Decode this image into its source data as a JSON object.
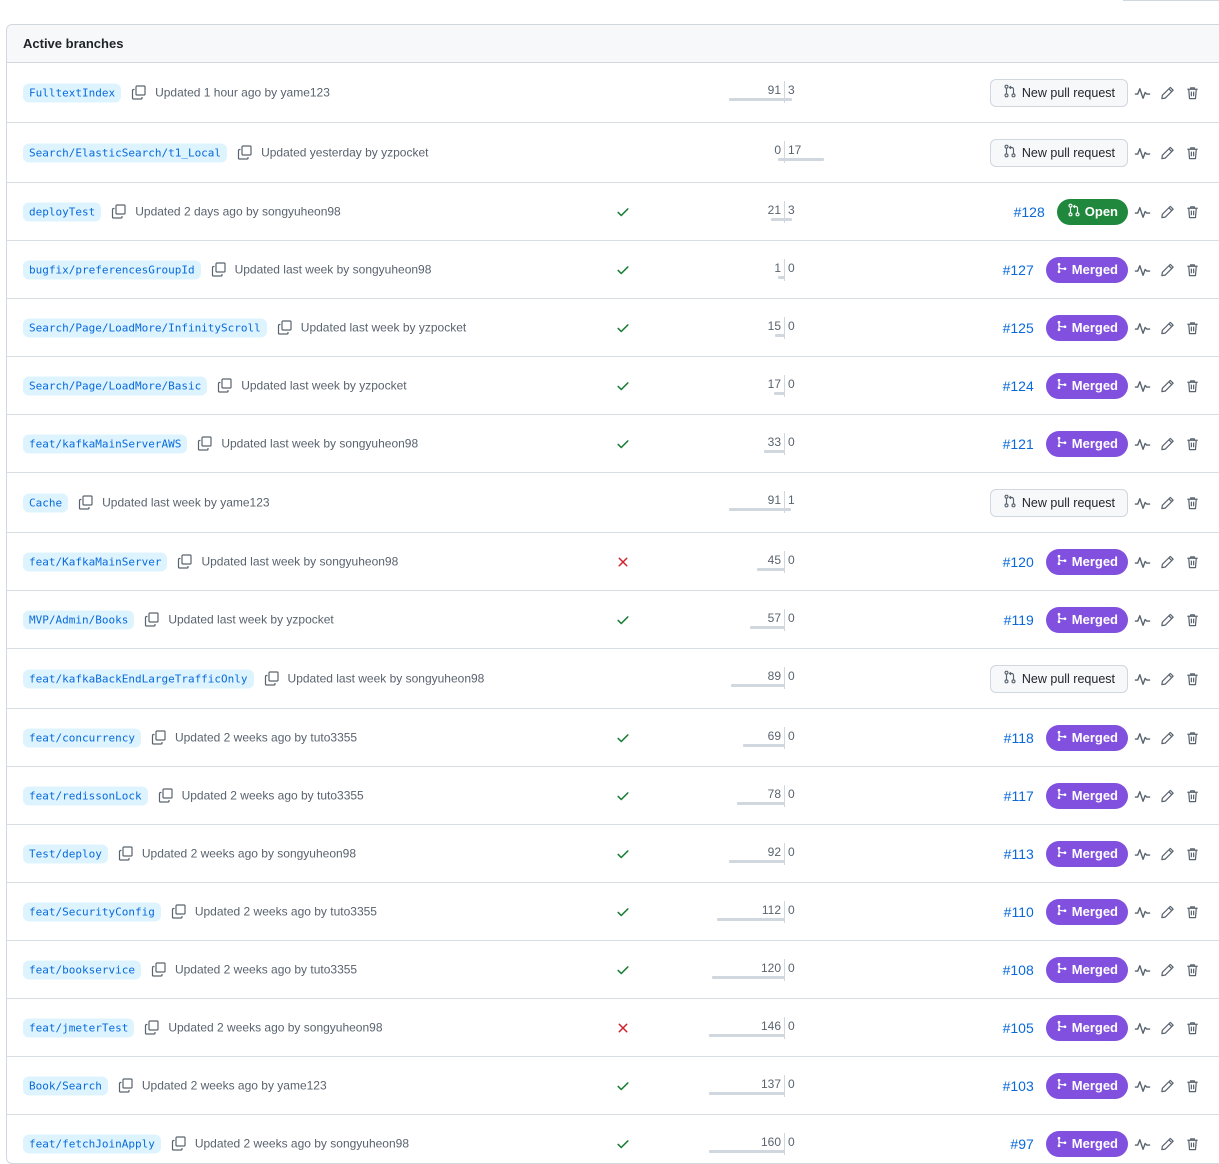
{
  "header": {
    "title": "Active branches"
  },
  "labels": {
    "new_pr": "New pull request",
    "merged": "Merged",
    "open": "Open"
  },
  "colors": {
    "link": "#0969da",
    "merged": "#8250df",
    "open": "#1f883d",
    "check_success": "#1a7f37",
    "check_failure": "#cf222e"
  },
  "branches": [
    {
      "name": "FulltextIndex",
      "updated": "Updated 1 hour ago by yame123",
      "status": "none",
      "behind": "91",
      "ahead": "3",
      "pr_type": "new",
      "pr_number": ""
    },
    {
      "name": "Search/ElasticSearch/t1_Local",
      "updated": "Updated yesterday by yzpocket",
      "status": "none",
      "behind": "0",
      "ahead": "17",
      "pr_type": "new",
      "pr_number": ""
    },
    {
      "name": "deployTest",
      "updated": "Updated 2 days ago by songyuheon98",
      "status": "success",
      "behind": "21",
      "ahead": "3",
      "pr_type": "open",
      "pr_number": "#128"
    },
    {
      "name": "bugfix/preferencesGroupId",
      "updated": "Updated last week by songyuheon98",
      "status": "success",
      "behind": "1",
      "ahead": "0",
      "pr_type": "merged",
      "pr_number": "#127"
    },
    {
      "name": "Search/Page/LoadMore/InfinityScroll",
      "updated": "Updated last week by yzpocket",
      "status": "success",
      "behind": "15",
      "ahead": "0",
      "pr_type": "merged",
      "pr_number": "#125"
    },
    {
      "name": "Search/Page/LoadMore/Basic",
      "updated": "Updated last week by yzpocket",
      "status": "success",
      "behind": "17",
      "ahead": "0",
      "pr_type": "merged",
      "pr_number": "#124"
    },
    {
      "name": "feat/kafkaMainServerAWS",
      "updated": "Updated last week by songyuheon98",
      "status": "success",
      "behind": "33",
      "ahead": "0",
      "pr_type": "merged",
      "pr_number": "#121"
    },
    {
      "name": "Cache",
      "updated": "Updated last week by yame123",
      "status": "none",
      "behind": "91",
      "ahead": "1",
      "pr_type": "new",
      "pr_number": ""
    },
    {
      "name": "feat/KafkaMainServer",
      "updated": "Updated last week by songyuheon98",
      "status": "failure",
      "behind": "45",
      "ahead": "0",
      "pr_type": "merged",
      "pr_number": "#120"
    },
    {
      "name": "MVP/Admin/Books",
      "updated": "Updated last week by yzpocket",
      "status": "success",
      "behind": "57",
      "ahead": "0",
      "pr_type": "merged",
      "pr_number": "#119"
    },
    {
      "name": "feat/kafkaBackEndLargeTrafficOnly",
      "updated": "Updated last week by songyuheon98",
      "status": "none",
      "behind": "89",
      "ahead": "0",
      "pr_type": "new",
      "pr_number": ""
    },
    {
      "name": "feat/concurrency",
      "updated": "Updated 2 weeks ago by tuto3355",
      "status": "success",
      "behind": "69",
      "ahead": "0",
      "pr_type": "merged",
      "pr_number": "#118"
    },
    {
      "name": "feat/redissonLock",
      "updated": "Updated 2 weeks ago by tuto3355",
      "status": "success",
      "behind": "78",
      "ahead": "0",
      "pr_type": "merged",
      "pr_number": "#117"
    },
    {
      "name": "Test/deploy",
      "updated": "Updated 2 weeks ago by songyuheon98",
      "status": "success",
      "behind": "92",
      "ahead": "0",
      "pr_type": "merged",
      "pr_number": "#113"
    },
    {
      "name": "feat/SecurityConfig",
      "updated": "Updated 2 weeks ago by tuto3355",
      "status": "success",
      "behind": "112",
      "ahead": "0",
      "pr_type": "merged",
      "pr_number": "#110"
    },
    {
      "name": "feat/bookservice",
      "updated": "Updated 2 weeks ago by tuto3355",
      "status": "success",
      "behind": "120",
      "ahead": "0",
      "pr_type": "merged",
      "pr_number": "#108"
    },
    {
      "name": "feat/jmeterTest",
      "updated": "Updated 2 weeks ago by songyuheon98",
      "status": "failure",
      "behind": "146",
      "ahead": "0",
      "pr_type": "merged",
      "pr_number": "#105"
    },
    {
      "name": "Book/Search",
      "updated": "Updated 2 weeks ago by yame123",
      "status": "success",
      "behind": "137",
      "ahead": "0",
      "pr_type": "merged",
      "pr_number": "#103"
    },
    {
      "name": "feat/fetchJoinApply",
      "updated": "Updated 2 weeks ago by songyuheon98",
      "status": "success",
      "behind": "160",
      "ahead": "0",
      "pr_type": "merged",
      "pr_number": "#97"
    }
  ]
}
